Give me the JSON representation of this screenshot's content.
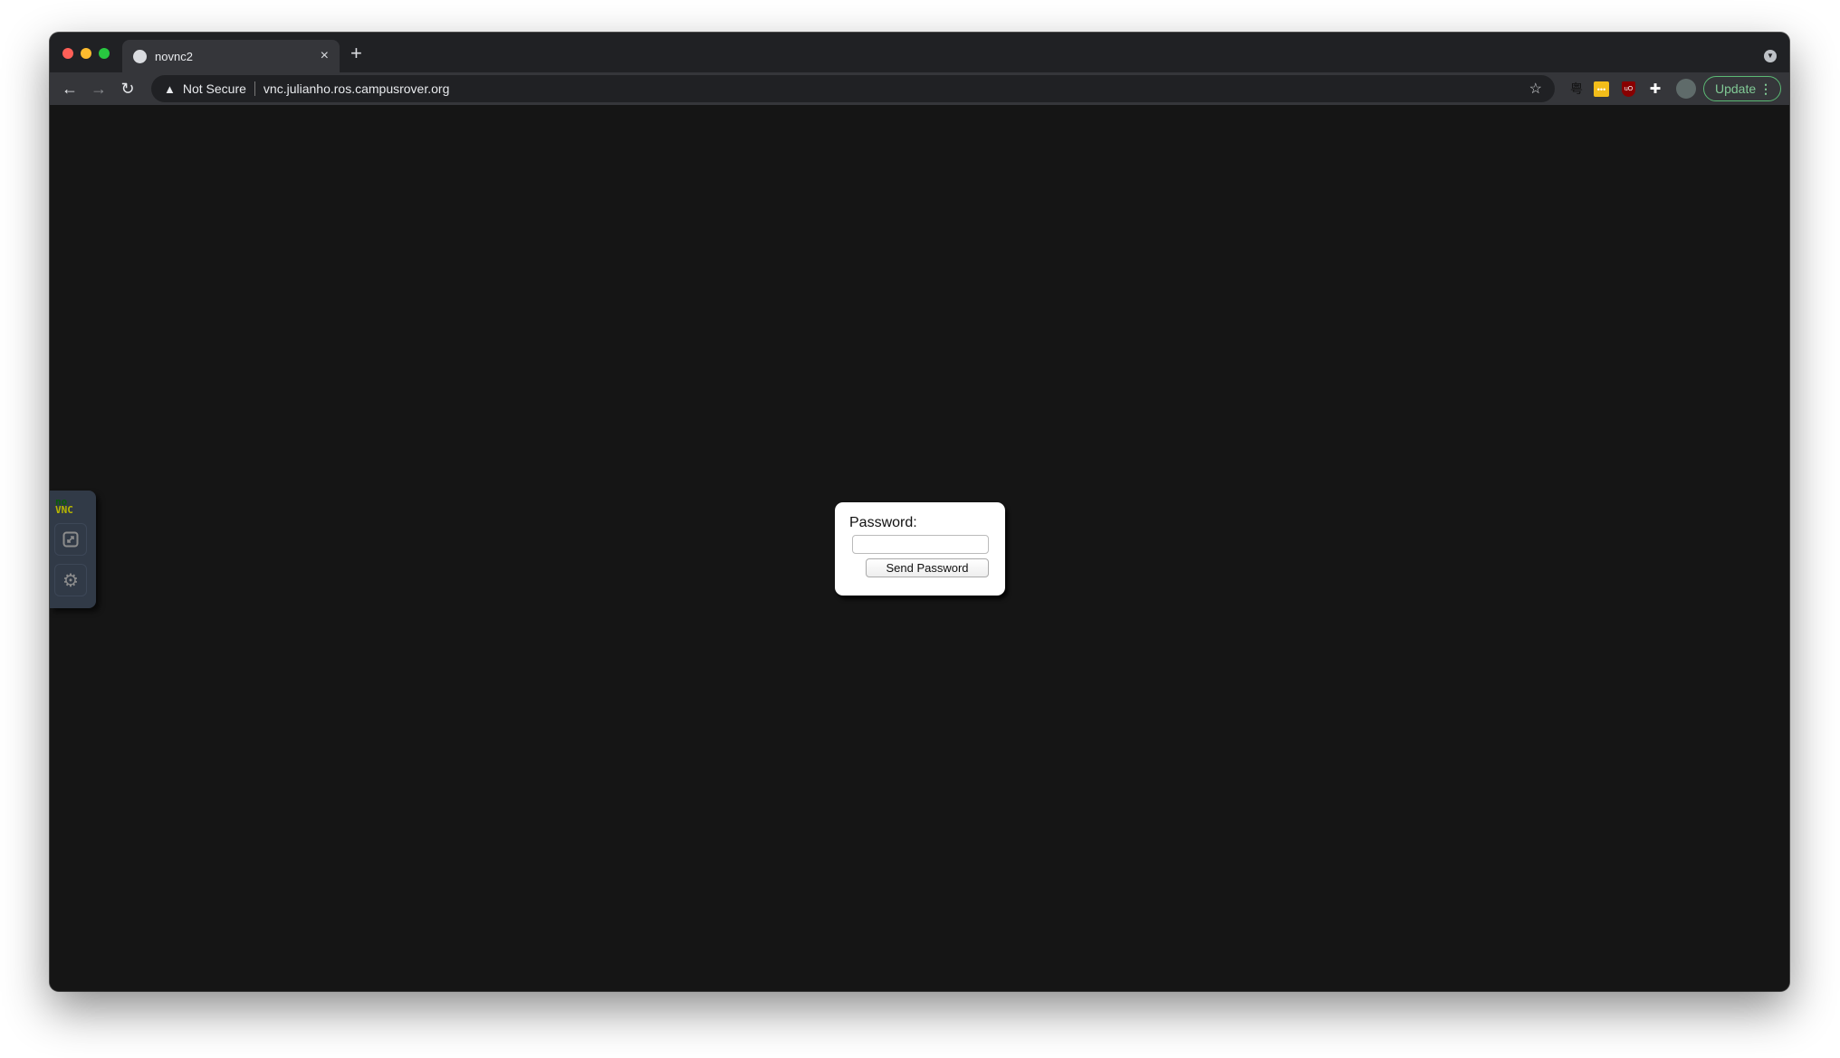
{
  "browser": {
    "tab_title": "novnc2",
    "new_tab": "+",
    "close": "×",
    "security_label": "Not Secure",
    "url": "vnc.julianho.ros.campusrover.org",
    "update_label": "Update",
    "colors": {
      "accent": "#5bb974",
      "red": "#ff5f57",
      "yellow": "#febc2e",
      "green": "#28c840"
    }
  },
  "sidebar": {
    "logo_top": "no",
    "logo_bottom": "VNC",
    "icons": [
      "fullscreen-icon",
      "gear-icon"
    ]
  },
  "dialog": {
    "label": "Password:",
    "input_value": "",
    "button_label": "Send Password"
  }
}
